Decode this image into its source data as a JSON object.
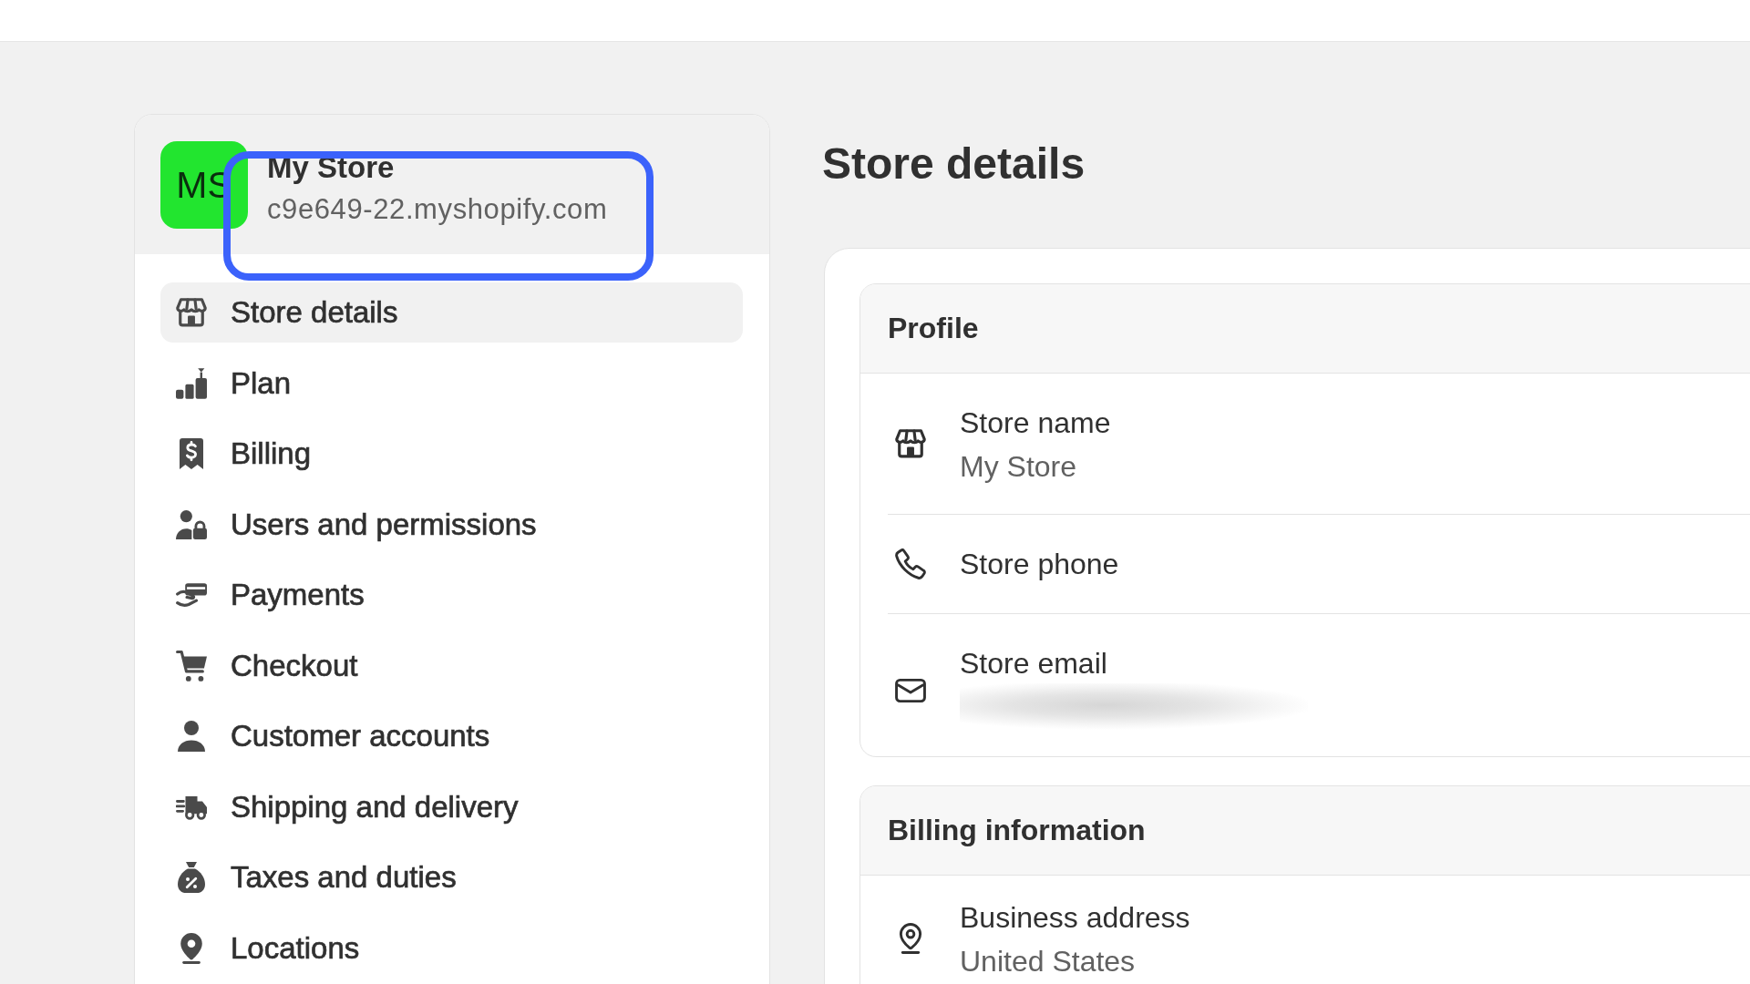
{
  "store": {
    "initials": "MS",
    "name": "My Store",
    "domain": "c9e649-22.myshopify.com",
    "highlighted": true
  },
  "sidebar": {
    "items": [
      {
        "label": "Store details",
        "selected": true
      },
      {
        "label": "Plan",
        "selected": false
      },
      {
        "label": "Billing",
        "selected": false
      },
      {
        "label": "Users and permissions",
        "selected": false
      },
      {
        "label": "Payments",
        "selected": false
      },
      {
        "label": "Checkout",
        "selected": false
      },
      {
        "label": "Customer accounts",
        "selected": false
      },
      {
        "label": "Shipping and delivery",
        "selected": false
      },
      {
        "label": "Taxes and duties",
        "selected": false
      },
      {
        "label": "Locations",
        "selected": false
      }
    ]
  },
  "page": {
    "title": "Store details"
  },
  "sections": [
    {
      "title": "Profile",
      "rows": [
        {
          "label": "Store name",
          "value": "My Store",
          "redacted": false
        },
        {
          "label": "Store phone",
          "redacted": false
        },
        {
          "label": "Store email",
          "redacted": true
        }
      ]
    },
    {
      "title": "Billing information",
      "rows": [
        {
          "label": "Business address",
          "value": "United States",
          "redacted": false
        }
      ]
    }
  ]
}
